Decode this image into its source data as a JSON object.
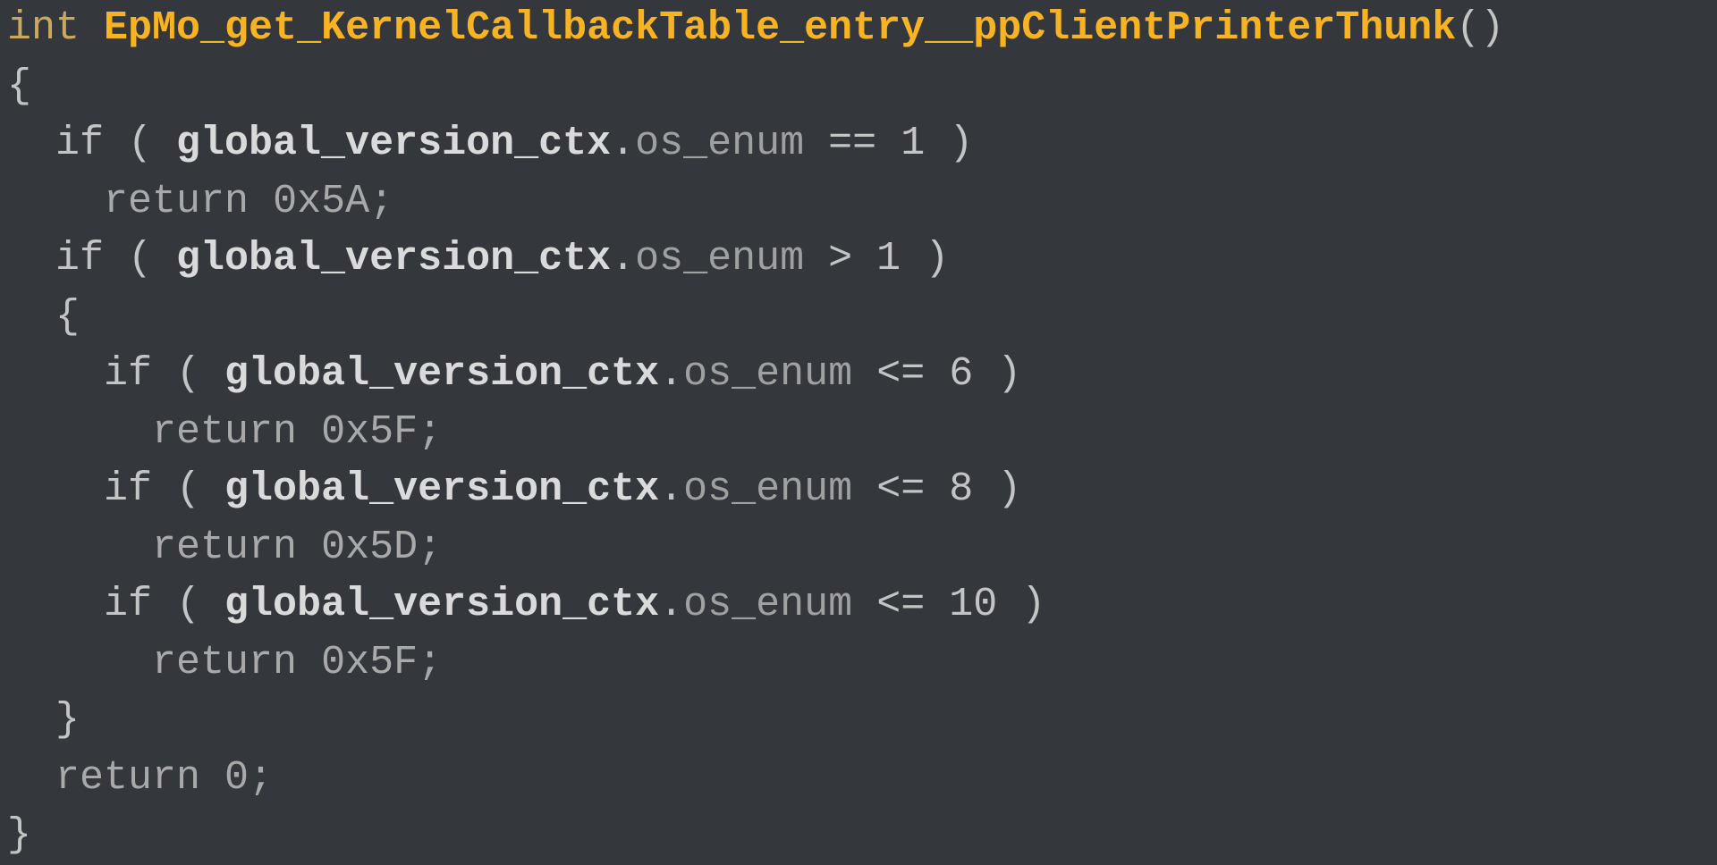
{
  "code": {
    "ret_type": "int",
    "fn_name": "EpMo_get_KernelCallbackTable_entry__ppClientPrinterThunk",
    "parens": "()",
    "open_brace": "{",
    "if1": {
      "kw": "  if ( ",
      "ident": "global_version_ctx",
      "dot": ".",
      "member": "os_enum",
      "op": " == 1 )",
      "ret": "    return ",
      "val": "0x5A;"
    },
    "if2": {
      "kw": "  if ( ",
      "ident": "global_version_ctx",
      "dot": ".",
      "member": "os_enum",
      "op": " > 1 )",
      "open": "  {",
      "a": {
        "kw": "    if ( ",
        "ident": "global_version_ctx",
        "dot": ".",
        "member": "os_enum",
        "op": " <= 6 )",
        "ret": "      return ",
        "val": "0x5F;"
      },
      "b": {
        "kw": "    if ( ",
        "ident": "global_version_ctx",
        "dot": ".",
        "member": "os_enum",
        "op": " <= 8 )",
        "ret": "      return ",
        "val": "0x5D;"
      },
      "c": {
        "kw": "    if ( ",
        "ident": "global_version_ctx",
        "dot": ".",
        "member": "os_enum",
        "op": " <= 10 )",
        "ret": "      return ",
        "val": "0x5F;"
      },
      "close": "  }"
    },
    "final_ret": "  return ",
    "final_val": "0;",
    "close_brace": "}"
  }
}
